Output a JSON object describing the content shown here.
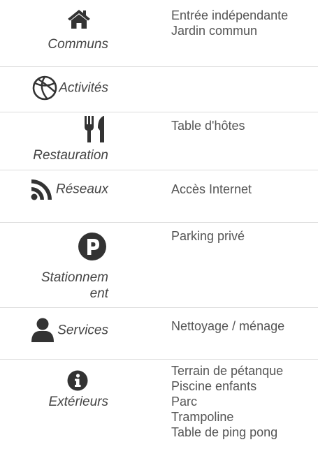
{
  "amenities": [
    {
      "category": "Communs",
      "icon": "home-icon",
      "features": [
        "Entrée indépendante",
        "Jardin commun"
      ]
    },
    {
      "category": "Activités",
      "icon": "basketball-icon",
      "features": []
    },
    {
      "category": "Restauration",
      "icon": "utensils-icon",
      "features": [
        "Table d'hôtes"
      ]
    },
    {
      "category": "Réseaux",
      "icon": "rss-icon",
      "features": [
        "Accès Internet"
      ]
    },
    {
      "category_line1": "Stationnem",
      "category_line2": "ent",
      "icon": "parking-icon",
      "features": [
        "Parking privé"
      ]
    },
    {
      "category": "Services",
      "icon": "user-icon",
      "features": [
        "Nettoyage / ménage"
      ]
    },
    {
      "category": "Extérieurs",
      "icon": "info-circle-icon",
      "features": [
        "Terrain de pétanque",
        "Piscine enfants",
        "Parc",
        "Trampoline",
        "Table de ping pong"
      ]
    }
  ]
}
